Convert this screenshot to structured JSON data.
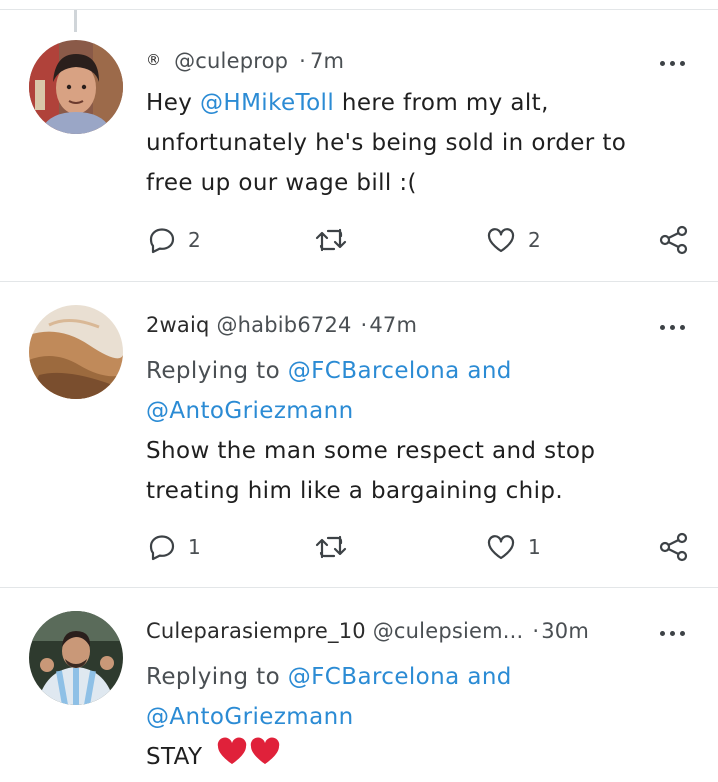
{
  "tweets": [
    {
      "badge": "®",
      "display_name": "",
      "handle": "@culeprop",
      "separator": "·",
      "time": "7m",
      "replying_line1": "",
      "replying_line2": "",
      "body_prefix": "Hey ",
      "body_mention": "@HMikeToll",
      "body_line1_rest": " here from my alt,",
      "body_line2": "unfortunately he's being sold in order to",
      "body_line3": "free up our wage bill :(",
      "reply_count": "2",
      "retweet_count": "",
      "like_count": "2"
    },
    {
      "display_name": "2waiq",
      "handle": "@habib6724",
      "separator": "·",
      "time": "47m",
      "replying_prefix": "Replying to ",
      "replying_mention1": "@FCBarcelona",
      "replying_and": " and",
      "replying_mention2": "@AntoGriezmann",
      "body_line1": "Show the man some respect and stop",
      "body_line2": "treating him like a bargaining chip.",
      "reply_count": "1",
      "retweet_count": "",
      "like_count": "1"
    },
    {
      "display_name": "Culeparasiempre_10",
      "handle": "@culepsiem...",
      "separator": "·",
      "time": "30m",
      "replying_prefix": "Replying to ",
      "replying_mention1": "@FCBarcelona",
      "replying_and": " and",
      "replying_mention2": "@AntoGriezmann",
      "body_line1": "STAY",
      "body_emoji": "heart-emoji x2"
    }
  ],
  "icons": {
    "reply": "reply-icon",
    "retweet": "retweet-icon",
    "like": "like-icon",
    "share": "share-icon",
    "more": "more-icon"
  },
  "colors": {
    "link": "#2b8bd4",
    "heart": "#e0213a",
    "text": "#1f1f1f",
    "muted": "#4a4f53",
    "divider": "#e3e6e8"
  }
}
